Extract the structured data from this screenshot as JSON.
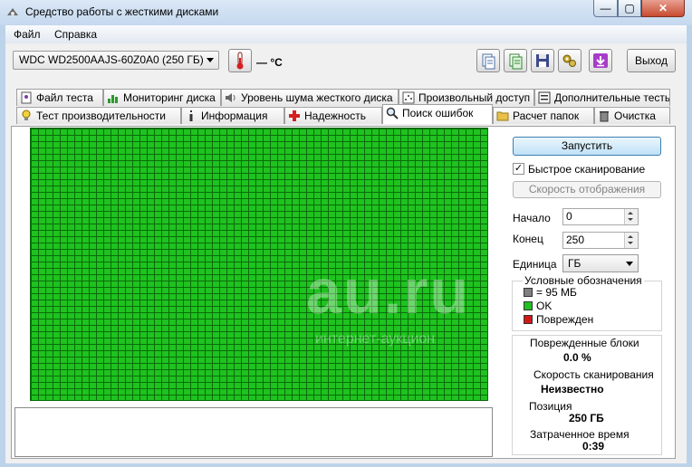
{
  "window": {
    "title": "Средство работы с жесткими дисками",
    "min": "—",
    "max": "▢",
    "close": "✕"
  },
  "menu": {
    "file": "Файл",
    "help": "Справка"
  },
  "toolbar": {
    "drive": "WDC WD2500AAJS-60Z0A0    (250 ГБ)",
    "temperature": "— °C",
    "exit": "Выход"
  },
  "tabs_row1": [
    "Файл теста",
    "Мониторинг диска",
    "Уровень шума жесткого диска",
    "Произвольный доступ",
    "Дополнительные тесты"
  ],
  "tabs_row2": [
    "Тест производительности",
    "Информация",
    "Надежность",
    "Поиск ошибок",
    "Расчет папок",
    "Очистка"
  ],
  "controls": {
    "start": "Запустить",
    "quick_scan": "Быстрое сканирование",
    "quick_scan_checked": true,
    "display_speed": "Скорость отображения",
    "start_label": "Начало",
    "start_value": "0",
    "end_label": "Конец",
    "end_value": "250",
    "unit_label": "Единица",
    "unit_value": "ГБ"
  },
  "legend": {
    "title": "Условные обозначения",
    "items": [
      {
        "label": "= 95 МБ",
        "color": "#808080"
      },
      {
        "label": "OK",
        "color": "#22c022"
      },
      {
        "label": "Поврежден",
        "color": "#d01818"
      }
    ]
  },
  "stats": {
    "bad_blocks_label": "Поврежденные блоки",
    "bad_blocks_value": "0.0 %",
    "scan_speed_label": "Скорость сканирования",
    "scan_speed_value": "Неизвестно",
    "position_label": "Позиция",
    "position_value": "250 ГБ",
    "elapsed_label": "Затраченное время",
    "elapsed_value": "0:39"
  },
  "watermark": {
    "main": "au.ru",
    "sub": "интернет-аукцион"
  },
  "colors": {
    "block_ok": "#1fc21f",
    "block_grid": "#0a6c0a"
  }
}
